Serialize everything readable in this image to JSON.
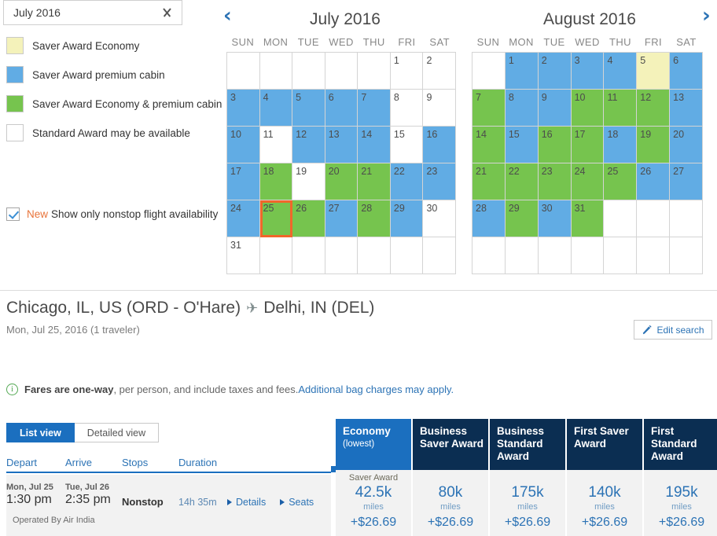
{
  "month_select": {
    "value": "July 2016",
    "icon": "chevron-down-icon"
  },
  "legend": {
    "items": [
      {
        "label": "Saver Award Economy",
        "color": "#F4F2BA"
      },
      {
        "label": "Saver Award premium cabin",
        "color": "#61ACE4"
      },
      {
        "label": "Saver Award Economy & premium cabin",
        "color": "#76C44E"
      },
      {
        "label": "Standard Award may be available",
        "color": "#FFFFFF"
      }
    ]
  },
  "nonstop_option": {
    "checked": true,
    "badge": "New",
    "label": "Show only nonstop flight availability"
  },
  "calendar_nav": {
    "prev": "‹",
    "next": "›"
  },
  "calendars": [
    {
      "title": "July 2016",
      "dows": [
        "SUN",
        "MON",
        "TUE",
        "WED",
        "THU",
        "FRI",
        "SAT"
      ],
      "weeks": [
        [
          {
            "d": "",
            "s": "empty"
          },
          {
            "d": "",
            "s": "empty"
          },
          {
            "d": "",
            "s": "empty"
          },
          {
            "d": "",
            "s": "empty"
          },
          {
            "d": "",
            "s": "empty"
          },
          {
            "d": "1",
            "s": "white"
          },
          {
            "d": "2",
            "s": "white"
          }
        ],
        [
          {
            "d": "3",
            "s": "blue"
          },
          {
            "d": "4",
            "s": "blue"
          },
          {
            "d": "5",
            "s": "blue"
          },
          {
            "d": "6",
            "s": "blue"
          },
          {
            "d": "7",
            "s": "blue"
          },
          {
            "d": "8",
            "s": "white"
          },
          {
            "d": "9",
            "s": "white"
          }
        ],
        [
          {
            "d": "10",
            "s": "blue"
          },
          {
            "d": "11",
            "s": "white"
          },
          {
            "d": "12",
            "s": "blue"
          },
          {
            "d": "13",
            "s": "blue"
          },
          {
            "d": "14",
            "s": "blue"
          },
          {
            "d": "15",
            "s": "white"
          },
          {
            "d": "16",
            "s": "blue"
          }
        ],
        [
          {
            "d": "17",
            "s": "blue"
          },
          {
            "d": "18",
            "s": "green"
          },
          {
            "d": "19",
            "s": "white"
          },
          {
            "d": "20",
            "s": "green"
          },
          {
            "d": "21",
            "s": "green"
          },
          {
            "d": "22",
            "s": "blue"
          },
          {
            "d": "23",
            "s": "blue"
          }
        ],
        [
          {
            "d": "24",
            "s": "blue"
          },
          {
            "d": "25",
            "s": "green",
            "selected": true
          },
          {
            "d": "26",
            "s": "green"
          },
          {
            "d": "27",
            "s": "blue"
          },
          {
            "d": "28",
            "s": "green"
          },
          {
            "d": "29",
            "s": "blue"
          },
          {
            "d": "30",
            "s": "white"
          }
        ],
        [
          {
            "d": "31",
            "s": "white"
          },
          {
            "d": "",
            "s": "empty"
          },
          {
            "d": "",
            "s": "empty"
          },
          {
            "d": "",
            "s": "empty"
          },
          {
            "d": "",
            "s": "empty"
          },
          {
            "d": "",
            "s": "empty"
          },
          {
            "d": "",
            "s": "empty"
          }
        ]
      ]
    },
    {
      "title": "August 2016",
      "dows": [
        "SUN",
        "MON",
        "TUE",
        "WED",
        "THU",
        "FRI",
        "SAT"
      ],
      "weeks": [
        [
          {
            "d": "",
            "s": "empty"
          },
          {
            "d": "1",
            "s": "blue"
          },
          {
            "d": "2",
            "s": "blue"
          },
          {
            "d": "3",
            "s": "blue"
          },
          {
            "d": "4",
            "s": "blue"
          },
          {
            "d": "5",
            "s": "yellow"
          },
          {
            "d": "6",
            "s": "blue"
          }
        ],
        [
          {
            "d": "7",
            "s": "green"
          },
          {
            "d": "8",
            "s": "blue"
          },
          {
            "d": "9",
            "s": "blue"
          },
          {
            "d": "10",
            "s": "green"
          },
          {
            "d": "11",
            "s": "green"
          },
          {
            "d": "12",
            "s": "green"
          },
          {
            "d": "13",
            "s": "blue"
          }
        ],
        [
          {
            "d": "14",
            "s": "green"
          },
          {
            "d": "15",
            "s": "blue"
          },
          {
            "d": "16",
            "s": "green"
          },
          {
            "d": "17",
            "s": "green"
          },
          {
            "d": "18",
            "s": "blue"
          },
          {
            "d": "19",
            "s": "green"
          },
          {
            "d": "20",
            "s": "blue"
          }
        ],
        [
          {
            "d": "21",
            "s": "green"
          },
          {
            "d": "22",
            "s": "green"
          },
          {
            "d": "23",
            "s": "green"
          },
          {
            "d": "24",
            "s": "green"
          },
          {
            "d": "25",
            "s": "green"
          },
          {
            "d": "26",
            "s": "blue"
          },
          {
            "d": "27",
            "s": "blue"
          }
        ],
        [
          {
            "d": "28",
            "s": "blue"
          },
          {
            "d": "29",
            "s": "green"
          },
          {
            "d": "30",
            "s": "blue"
          },
          {
            "d": "31",
            "s": "green"
          },
          {
            "d": "",
            "s": "empty"
          },
          {
            "d": "",
            "s": "empty"
          },
          {
            "d": "",
            "s": "empty"
          }
        ],
        [
          {
            "d": "",
            "s": "empty"
          },
          {
            "d": "",
            "s": "empty"
          },
          {
            "d": "",
            "s": "empty"
          },
          {
            "d": "",
            "s": "empty"
          },
          {
            "d": "",
            "s": "empty"
          },
          {
            "d": "",
            "s": "empty"
          },
          {
            "d": "",
            "s": "empty"
          }
        ]
      ]
    }
  ],
  "route": {
    "origin": "Chicago, IL, US (ORD - O'Hare)",
    "plane_icon": "✈",
    "destination": "Delhi, IN (DEL)",
    "subtitle": "Mon, Jul 25, 2016 (1 traveler)",
    "edit_button": "Edit search"
  },
  "info_bar": {
    "bold": "Fares are one-way",
    "normal": ", per person, and include taxes and fees. ",
    "link": "Additional bag charges may apply."
  },
  "view_tabs": [
    {
      "label": "List view",
      "active": true
    },
    {
      "label": "Detailed view",
      "active": false
    }
  ],
  "columns": {
    "depart": "Depart",
    "arrive": "Arrive",
    "stops": "Stops",
    "duration": "Duration"
  },
  "flight": {
    "depart_date": "Mon, Jul 25",
    "depart_time": "1:30 pm",
    "arrive_date": "Tue, Jul 26",
    "arrive_time": "2:35 pm",
    "stops": "Nonstop",
    "duration": "14h 35m",
    "details_link": "Details",
    "seats_link": "Seats",
    "operated_by": "Operated By Air India"
  },
  "fares": [
    {
      "title": "Economy",
      "sub": "(lowest)",
      "tag": "Saver Award",
      "miles": "42.5k",
      "unit": "miles",
      "price": "+$26.69",
      "highlight": true
    },
    {
      "title": "Business Saver Award",
      "sub": "",
      "tag": "",
      "miles": "80k",
      "unit": "miles",
      "price": "+$26.69",
      "highlight": false
    },
    {
      "title": "Business Standard Award",
      "sub": "",
      "tag": "",
      "miles": "175k",
      "unit": "miles",
      "price": "+$26.69",
      "highlight": false
    },
    {
      "title": "First Saver Award",
      "sub": "",
      "tag": "",
      "miles": "140k",
      "unit": "miles",
      "price": "+$26.69",
      "highlight": false
    },
    {
      "title": "First Standard Award",
      "sub": "",
      "tag": "",
      "miles": "195k",
      "unit": "miles",
      "price": "+$26.69",
      "highlight": false
    }
  ]
}
